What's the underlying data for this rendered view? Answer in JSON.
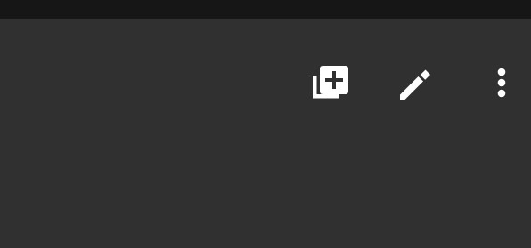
{
  "colors": {
    "status_bar": "#161616",
    "app_bar": "#303030",
    "icon": "#ffffff"
  },
  "toolbar": {
    "actions": [
      {
        "id": "add-to-library",
        "icon": "library-add-icon"
      },
      {
        "id": "edit",
        "icon": "pencil-icon"
      },
      {
        "id": "more-options",
        "icon": "more-vertical-icon"
      }
    ]
  }
}
